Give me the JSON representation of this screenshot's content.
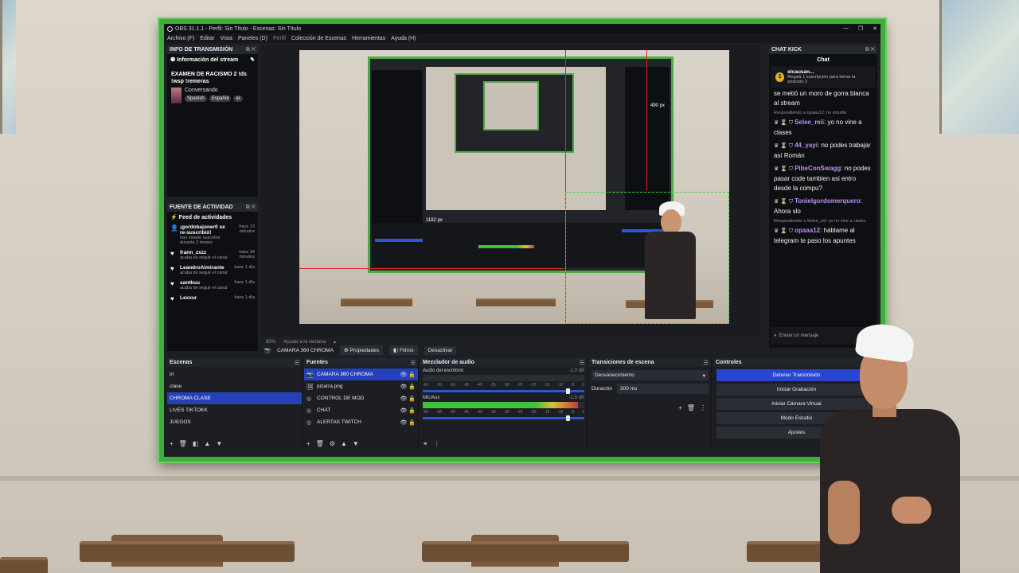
{
  "window": {
    "title": "OBS 31.1.1 - Perfil: Sin Título - Escenas: Sin Título",
    "controls": [
      "—",
      "❐",
      "✕"
    ]
  },
  "menu": [
    "Archivo (F)",
    "Editar",
    "Vista",
    "Paneles (D)",
    "Perfil",
    "Colección de Escenas",
    "Herramientas",
    "Ayuda (H)"
  ],
  "stream_info": {
    "header": "INFO DE TRANSMISIÓN",
    "sub": "Información del stream",
    "title": "EXAMEN DE RACISMO 2 !ds !wsp !remeras",
    "category": "Conversando",
    "tags": [
      "Spanish",
      "Español",
      "ar"
    ]
  },
  "activity": {
    "header": "FUENTE DE ACTIVIDAD",
    "sub": "Feed de actividades",
    "items": [
      {
        "icon": "👤",
        "name": "¡gordobajoner0 se re-suscribió!",
        "desc": "han estado suscritos durante 2 meses",
        "time": "hace 13 minutos"
      },
      {
        "icon": "♥",
        "name": "frann_zxzz",
        "desc": "acaba de seguir el canal",
        "time": "hace 34 minutos"
      },
      {
        "icon": "♥",
        "name": "LeandroAlmirante",
        "desc": "acaba de seguir el canal",
        "time": "hace 1 día"
      },
      {
        "icon": "♥",
        "name": "santkuu",
        "desc": "acaba de seguir el canal",
        "time": "hace 1 día"
      },
      {
        "icon": "♥",
        "name": "Lexxur",
        "desc": "",
        "time": "hace 1 día"
      }
    ]
  },
  "preview": {
    "zoom": "60%",
    "fit": "Ajustar a la ventana",
    "inner_px": "1182 px",
    "inner_px2": "490 px"
  },
  "source_bar": {
    "source": "CAMARA 360 CHROMA",
    "properties": "Propiedades",
    "filters": "Filtros",
    "deactivate": "Desactivar"
  },
  "chat": {
    "header": "CHAT KICK",
    "title": "Chat",
    "pinned": {
      "name": "elcausan...",
      "desc": "Regala 1 suscripción para tomar la posición 2"
    },
    "messages": [
      {
        "reply": "",
        "user": "",
        "color": "#ffffff",
        "text": "se metió un moro de gorra blanca al stream"
      },
      {
        "reply": "Respondiendo a opaaa12: no estudie",
        "user": "Selee_mii",
        "color": "#b98ff0",
        "text": "yo no vine a clases"
      },
      {
        "reply": "",
        "user": "44_yayi",
        "color": "#b98ff0",
        "text": "no podes trabajar así Román"
      },
      {
        "reply": "",
        "user": "PibeConSwagg",
        "color": "#b98ff0",
        "text": "no podes pasar code tambien asi entro desde la compu?"
      },
      {
        "reply": "",
        "user": "Tonielgordomerquero",
        "color": "#b98ff0",
        "text": "Ahora slo"
      },
      {
        "reply": "Respondiendo a Selee_mii: yo no vine a clases",
        "user": "opaaa12",
        "color": "#b98ff0",
        "text": "háblame al telegram te paso los apuntes"
      }
    ],
    "input_placeholder": "Enviar un mensaje"
  },
  "scenes": {
    "header": "Escenas",
    "items": [
      "irl",
      "clase",
      "CHROMA CLASE",
      "LIVES TIKTOKK",
      "JUEGOS"
    ],
    "selected": "CHROMA CLASE"
  },
  "sources": {
    "header": "Fuentes",
    "items": [
      {
        "icon": "📷",
        "name": "CAMARA 360 CHROMA"
      },
      {
        "icon": "🖼",
        "name": "pizarra.png"
      },
      {
        "icon": "◎",
        "name": "CONTROL DE MOD"
      },
      {
        "icon": "◎",
        "name": "CHAT"
      },
      {
        "icon": "◎",
        "name": "ALERTAS TWITCH"
      }
    ]
  },
  "mixer": {
    "header": "Mezclador de audio",
    "channels": [
      {
        "name": "Audio del escritorio",
        "db": "-1.0 dB",
        "level": 0
      },
      {
        "name": "Mic/Aux",
        "db": "-1.0 dB",
        "level": 0.96
      }
    ],
    "scale": [
      "-60",
      "-55",
      "-50",
      "-45",
      "-40",
      "-35",
      "-30",
      "-25",
      "-20",
      "-15",
      "-10",
      "-5",
      "0"
    ]
  },
  "transitions": {
    "header": "Transiciones de escena",
    "selected": "Desvanecimiento",
    "duration_label": "Duración",
    "duration": "300 ms"
  },
  "controls": {
    "header": "Controles",
    "buttons": [
      "Detener Transmisión",
      "Iniciar Grabación",
      "Iniciar Cámara Virtual",
      "Modo Estudio",
      "Ajustes"
    ]
  },
  "colors": {
    "accent": "#2946d0",
    "frame": "#3fae3a",
    "guide": "#e02020"
  }
}
